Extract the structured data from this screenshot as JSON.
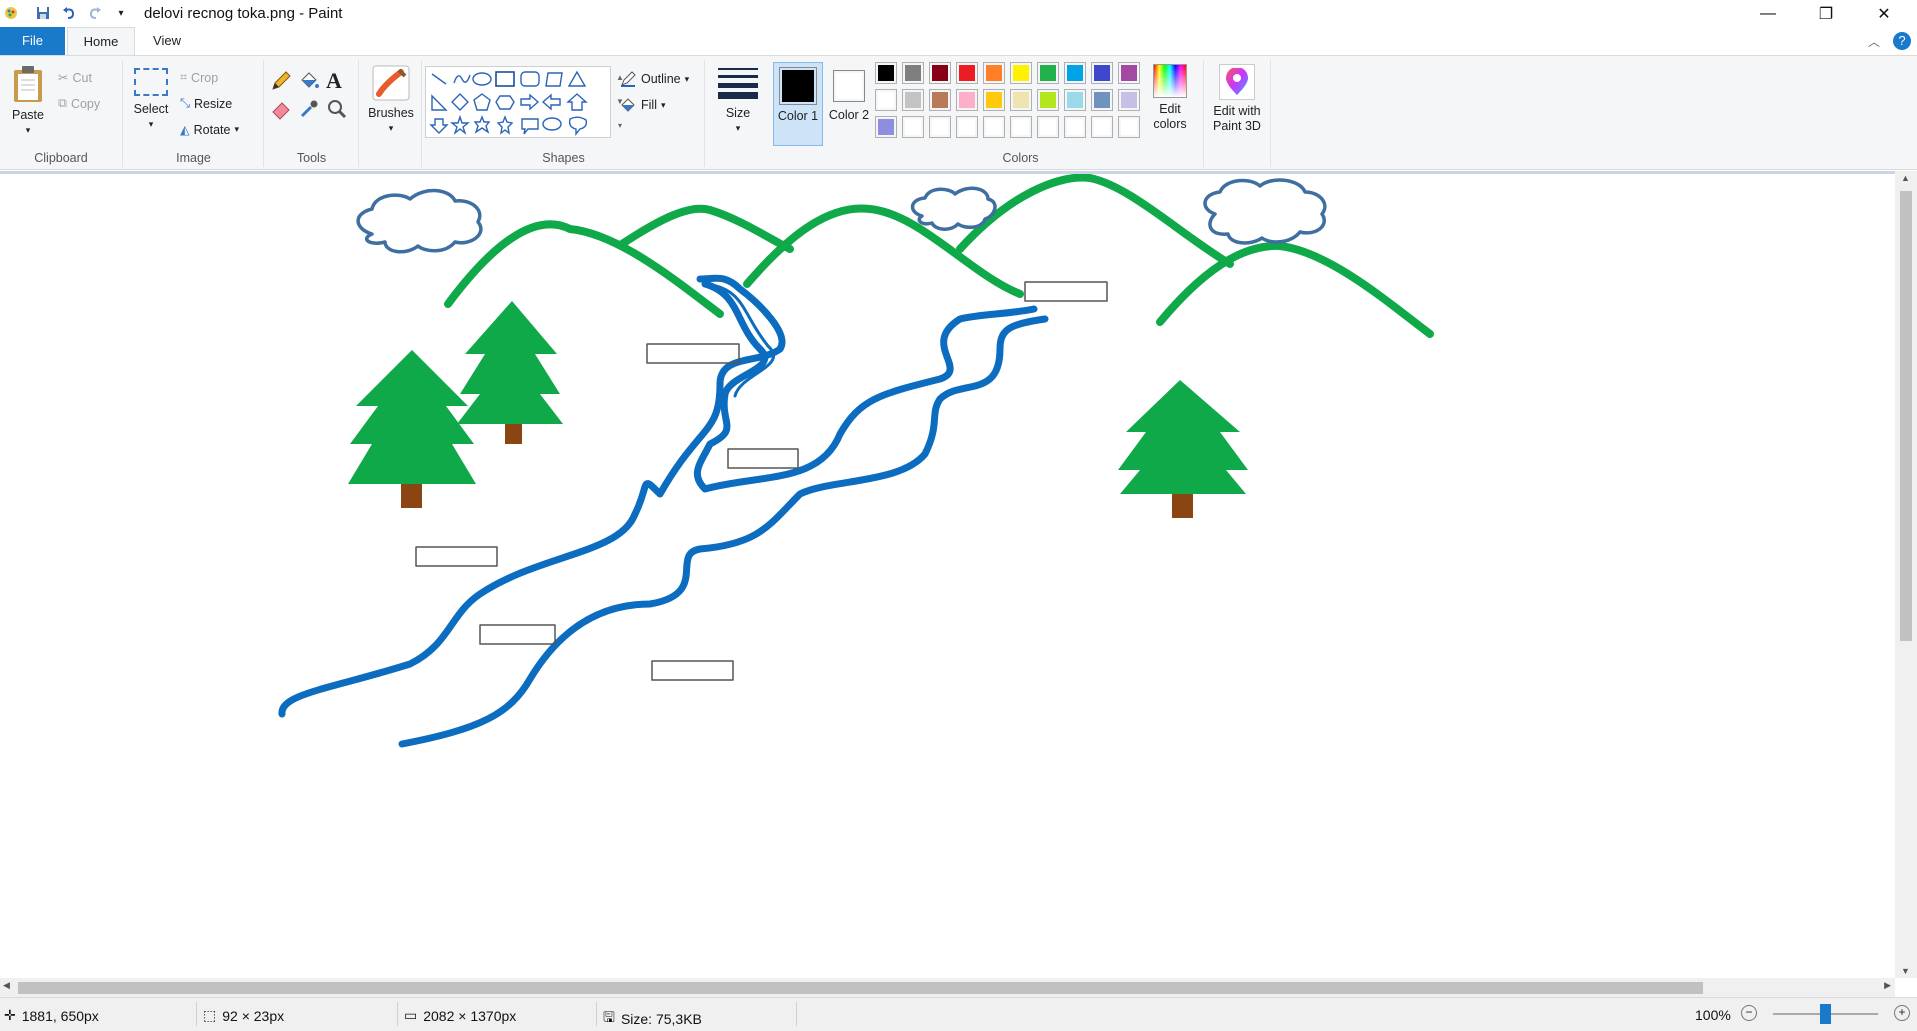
{
  "window": {
    "title": "delovi recnog toka.png - Paint",
    "minimize": "—",
    "restore": "❐",
    "close": "✕"
  },
  "tabs": {
    "file": "File",
    "home": "Home",
    "view": "View"
  },
  "ribbon": {
    "clipboard": {
      "label": "Clipboard",
      "paste": "Paste",
      "cut": "Cut",
      "copy": "Copy"
    },
    "image": {
      "label": "Image",
      "select": "Select",
      "crop": "Crop",
      "resize": "Resize",
      "rotate": "Rotate"
    },
    "tools": {
      "label": "Tools"
    },
    "brushes": {
      "label": "Brushes"
    },
    "shapes": {
      "label": "Shapes",
      "outline": "Outline",
      "fill": "Fill"
    },
    "size": {
      "label": "Size"
    },
    "colors": {
      "label": "Colors",
      "color1": "Color 1",
      "color2": "Color 2",
      "edit_colors": "Edit colors",
      "paint3d": "Edit with Paint 3D",
      "color1_value": "#000000",
      "color2_value": "#ffffff",
      "palette_row1": [
        "#000000",
        "#7f7f7f",
        "#880015",
        "#ed1c24",
        "#ff7f27",
        "#fff200",
        "#22b14c",
        "#00a2e8",
        "#3f48cc",
        "#a349a4"
      ],
      "palette_row2": [
        "#ffffff",
        "#c3c3c3",
        "#b97a57",
        "#ffaec9",
        "#ffc90e",
        "#efe4b0",
        "#b5e61d",
        "#99d9ea",
        "#7092be",
        "#c8bfe7"
      ],
      "palette_row3": [
        "#8e8ee0",
        "#ffffff",
        "#ffffff",
        "#ffffff",
        "#ffffff",
        "#ffffff",
        "#ffffff",
        "#ffffff",
        "#ffffff",
        "#ffffff"
      ]
    }
  },
  "drawing": {
    "colors": {
      "mountain": "#0fa94a",
      "river": "#0b6cc0",
      "tree": "#0fa94a",
      "trunk": "#8b4513",
      "cloud": "#3f6ea0",
      "box": "#555555"
    }
  },
  "status": {
    "cursor": "1881, 650px",
    "selection": "92 × 23px",
    "image_size": "2082 × 1370px",
    "file_size": "Size: 75,3KB",
    "zoom": "100%"
  }
}
